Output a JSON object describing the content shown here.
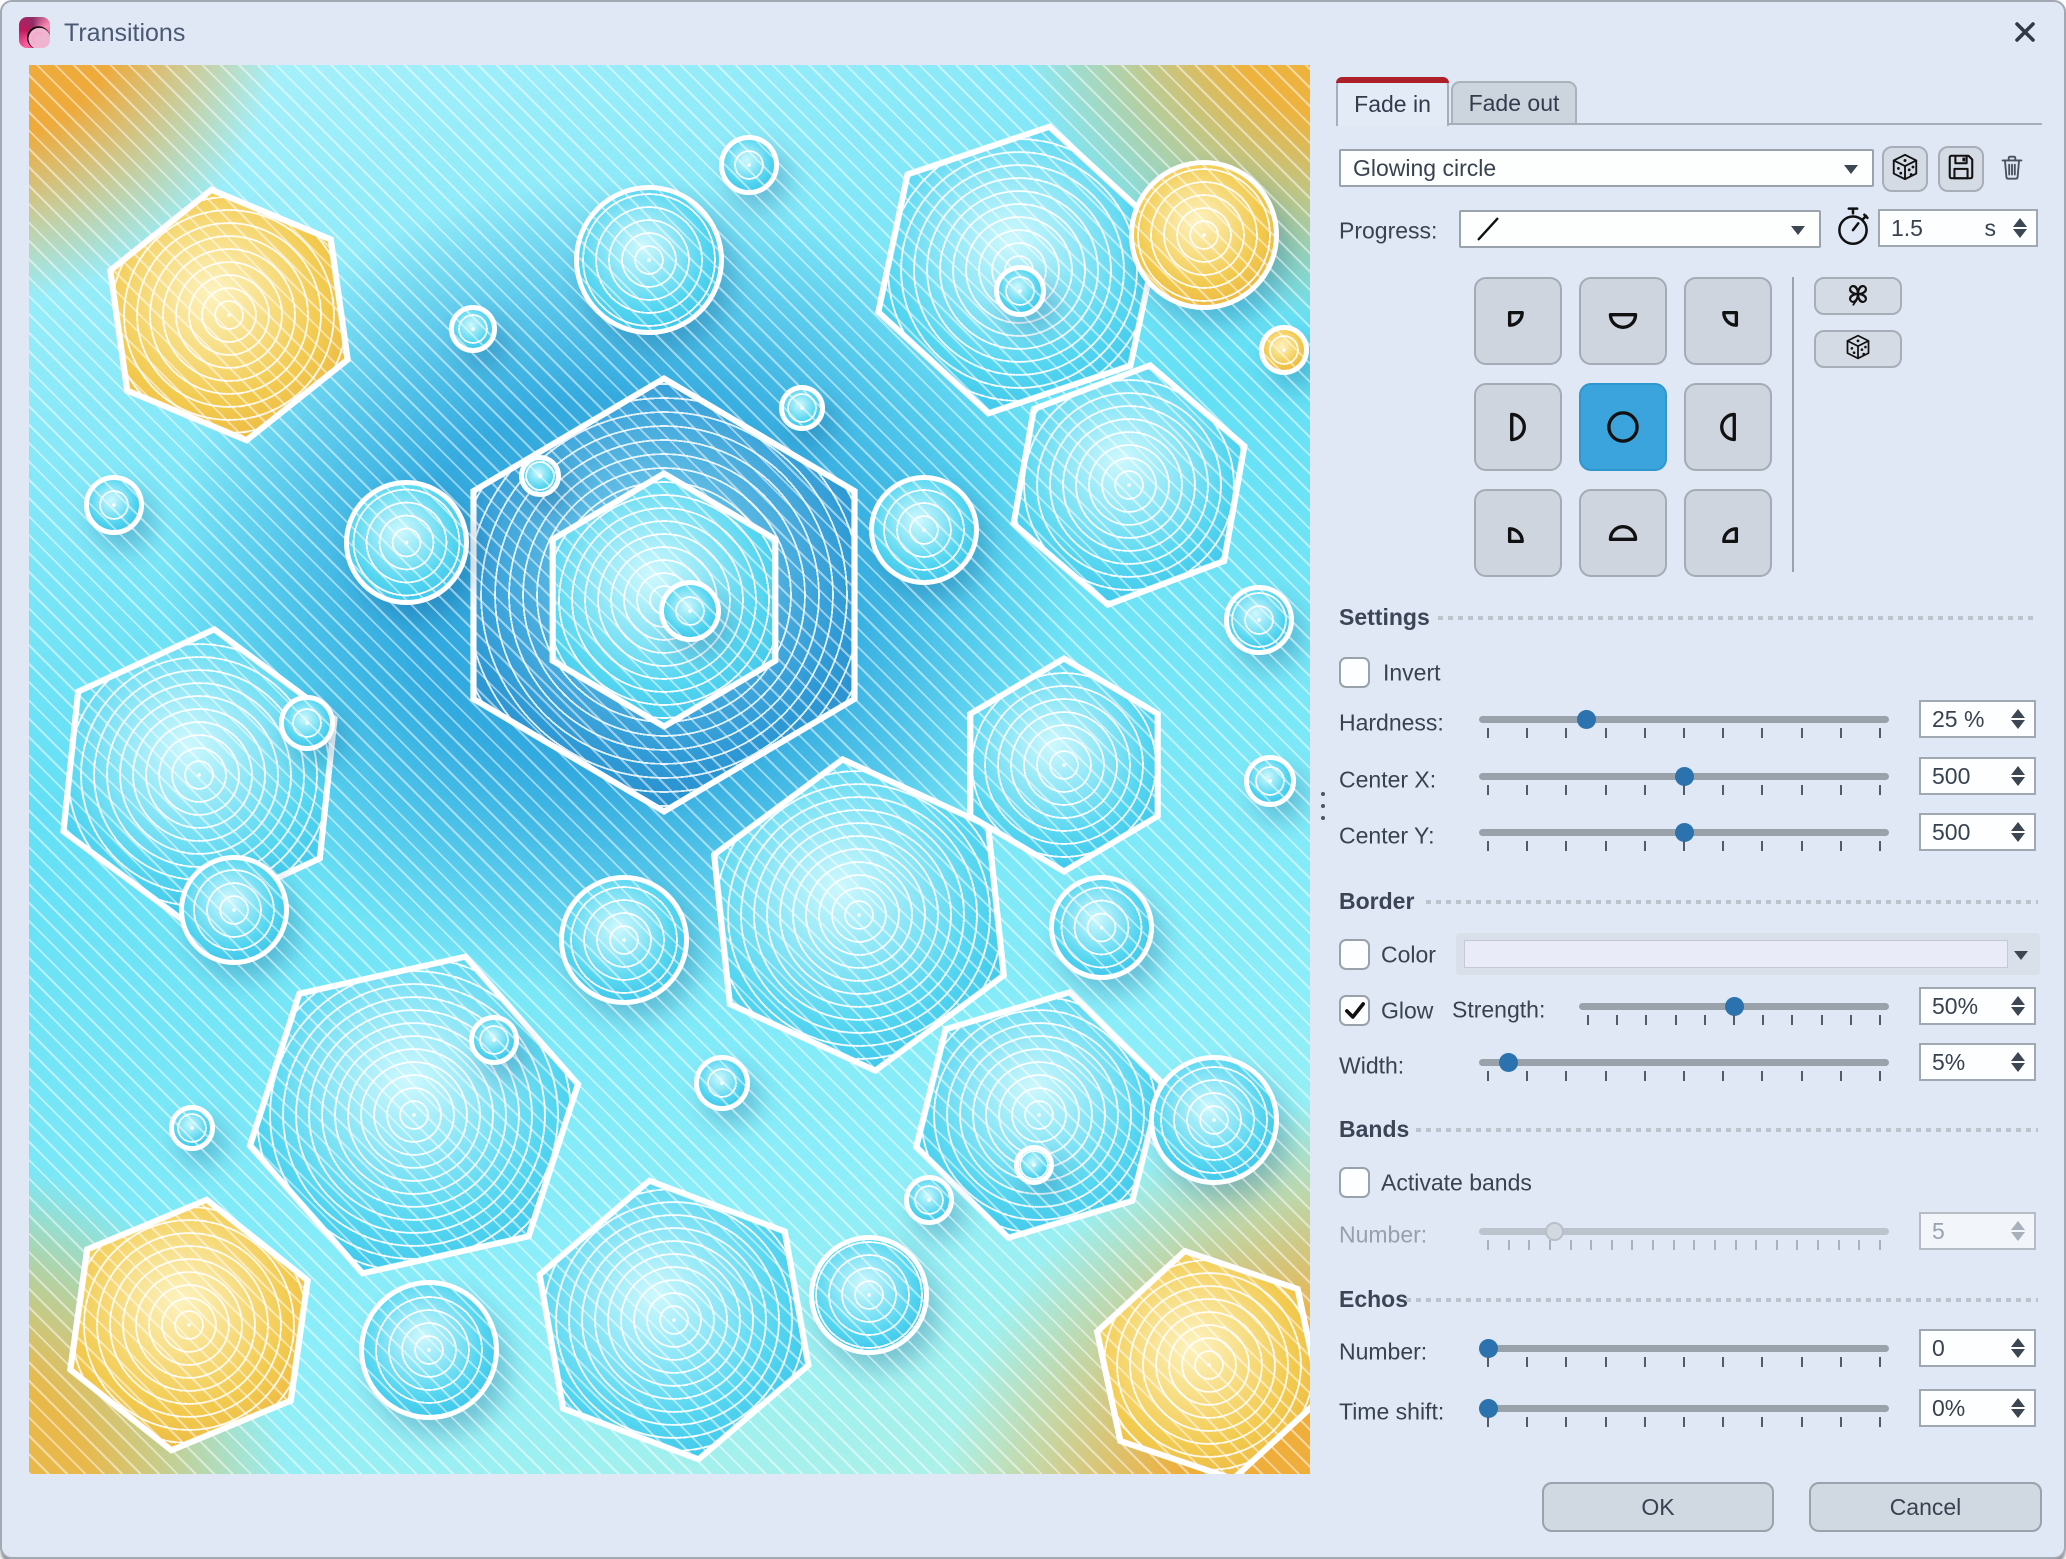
{
  "window": {
    "title": "Transitions"
  },
  "tabs": {
    "fade_in": "Fade in",
    "fade_out": "Fade out"
  },
  "preset": {
    "value": "Glowing circle",
    "buttons": [
      "dice-icon",
      "save-icon",
      "trash-icon"
    ]
  },
  "progress": {
    "label": "Progress:",
    "curve": "linear",
    "curve_icon": "linear-curve-icon",
    "timer_icon": "stopwatch-icon",
    "duration": "1.5",
    "unit": "s"
  },
  "origin_grid": {
    "selected": "center",
    "cells": [
      "top-left",
      "top",
      "top-right",
      "left",
      "center",
      "right",
      "bottom-left",
      "bottom",
      "bottom-right"
    ]
  },
  "side_buttons": [
    "clover-icon",
    "dice-icon"
  ],
  "sections": {
    "settings": {
      "title": "Settings",
      "checkboxes": [
        {
          "id": "invert",
          "label": "Invert",
          "checked": false
        }
      ],
      "sliders": [
        {
          "id": "hardness",
          "label": "Hardness:",
          "value": "25 %",
          "percent": 25,
          "ticks": 11,
          "disabled": false
        },
        {
          "id": "centerx",
          "label": "Center X:",
          "value": "500",
          "percent": 50,
          "ticks": 11,
          "disabled": false
        },
        {
          "id": "centery",
          "label": "Center Y:",
          "value": "500",
          "percent": 50,
          "ticks": 11,
          "disabled": false
        }
      ]
    },
    "border": {
      "title": "Border",
      "checkboxes": [
        {
          "id": "color",
          "label": "Color",
          "checked": false
        },
        {
          "id": "glow",
          "label": "Glow",
          "checked": true
        }
      ],
      "sliders": [
        {
          "id": "strength",
          "label": "Strength:",
          "value": "50%",
          "percent": 50,
          "ticks": 11,
          "disabled": false
        },
        {
          "id": "width",
          "label": "Width:",
          "value": "5%",
          "percent": 5,
          "ticks": 11,
          "disabled": false
        }
      ]
    },
    "bands": {
      "title": "Bands",
      "checkboxes": [
        {
          "id": "activate",
          "label": "Activate bands",
          "checked": false
        }
      ],
      "sliders": [
        {
          "id": "bands_number",
          "label": "Number:",
          "value": "5",
          "percent": 17,
          "ticks": 20,
          "disabled": true
        }
      ]
    },
    "echos": {
      "title": "Echos",
      "checkboxes": [],
      "sliders": [
        {
          "id": "echos_number",
          "label": "Number:",
          "value": "0",
          "percent": 0,
          "ticks": 11,
          "disabled": false
        },
        {
          "id": "time_shift",
          "label": "Time shift:",
          "value": "0%",
          "percent": 0,
          "ticks": 11,
          "disabled": false
        }
      ]
    }
  },
  "footer": {
    "ok": "OK",
    "cancel": "Cancel"
  },
  "preview": {
    "description": "glowing circle transition preview: cyan hexagon and circle pattern with orange corners and diagonal stripes"
  },
  "colors": {
    "window_bg": "#dfe8f4",
    "tab_accent": "#ae2029",
    "selected_cell": "#3ba4dc",
    "slider_handle": "#2b72ae",
    "preview_cyan": "#55d6f1",
    "preview_orange": "#f0a83b"
  }
}
